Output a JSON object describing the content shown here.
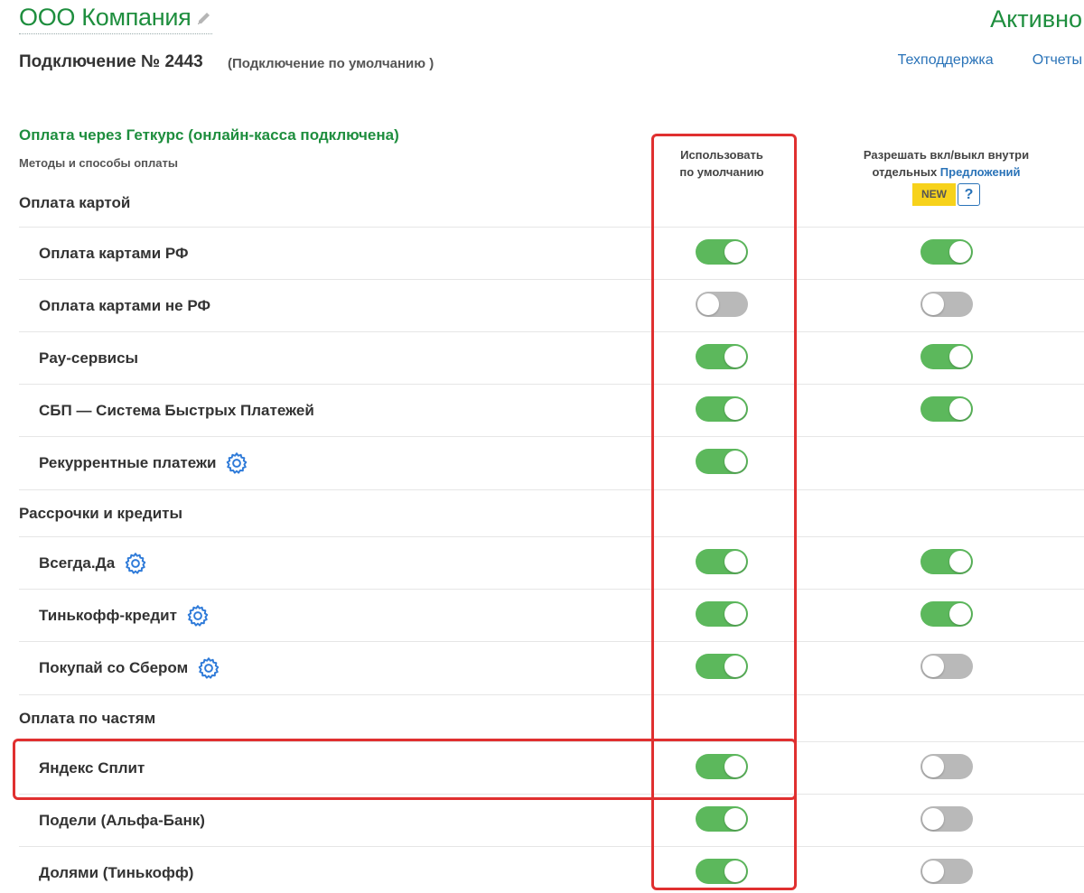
{
  "header": {
    "company_name": "ООО Компания",
    "status": "Активно",
    "connection_title": "Подключение № 2443",
    "connection_subtitle": "(Подключение по умолчанию )",
    "links": [
      "Техподдержка",
      "Отчеты"
    ]
  },
  "section": {
    "title": "Оплата через Геткурс (онлайн-касса подключена)",
    "methods_label": "Методы и способы оплаты"
  },
  "columns": {
    "default_line1": "Использовать",
    "default_line2": "по умолчанию",
    "allow_line1": "Разрешать вкл/выкл внутри",
    "allow_line2_prefix": "отдельных ",
    "allow_link": "Предложений",
    "badge_new": "NEW",
    "badge_help": "?"
  },
  "groups": [
    {
      "title": "Оплата картой",
      "rows": [
        {
          "label": "Оплата картами РФ",
          "gear": false,
          "default": true,
          "allow": true
        },
        {
          "label": "Оплата картами не РФ",
          "gear": false,
          "default": false,
          "allow": false
        },
        {
          "label": "Pay-сервисы",
          "gear": false,
          "default": true,
          "allow": true
        },
        {
          "label": "СБП — Система Быстрых Платежей",
          "gear": false,
          "default": true,
          "allow": true
        },
        {
          "label": "Рекуррентные платежи",
          "gear": true,
          "default": true,
          "allow": null
        }
      ]
    },
    {
      "title": "Рассрочки и кредиты",
      "rows": [
        {
          "label": "Всегда.Да",
          "gear": true,
          "default": true,
          "allow": true
        },
        {
          "label": "Тинькофф-кредит",
          "gear": true,
          "default": true,
          "allow": true
        },
        {
          "label": "Покупай со Сбером",
          "gear": true,
          "default": true,
          "allow": false
        }
      ]
    },
    {
      "title": "Оплата по частям",
      "rows": [
        {
          "label": "Яндекс Сплит",
          "gear": false,
          "default": true,
          "allow": false
        },
        {
          "label": "Подели (Альфа-Банк)",
          "gear": false,
          "default": true,
          "allow": false
        },
        {
          "label": "Долями (Тинькофф)",
          "gear": false,
          "default": true,
          "allow": false
        }
      ]
    }
  ],
  "colors": {
    "green_text": "#1e8e3e",
    "link": "#2a73b8",
    "toggle_on": "#5cb85c",
    "toggle_off": "#b9b9b9",
    "highlight": "#e03030",
    "badge_yellow": "#f7d21b"
  }
}
